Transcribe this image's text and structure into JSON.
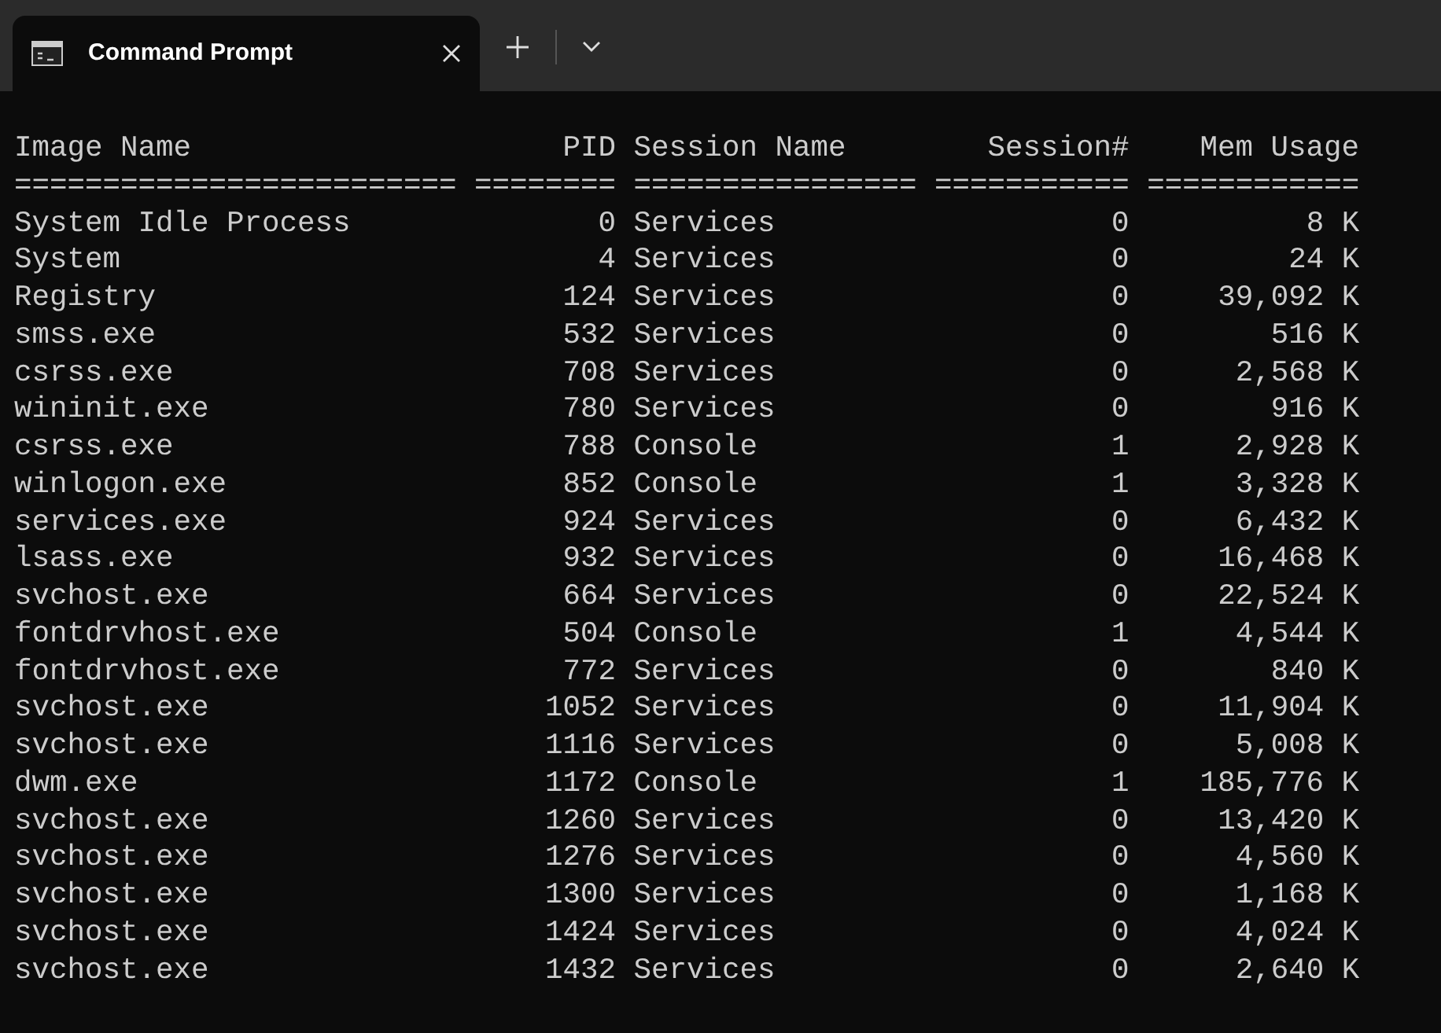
{
  "tabs": [
    {
      "title": "Command Prompt",
      "selected": true
    }
  ],
  "table": {
    "columns": [
      {
        "heading": "Image Name",
        "rule": "========================="
      },
      {
        "heading": "PID",
        "rule": "========"
      },
      {
        "heading": "Session Name",
        "rule": "================"
      },
      {
        "heading": "Session#",
        "rule": "==========="
      },
      {
        "heading": "Mem Usage",
        "rule": "============"
      }
    ],
    "rows": [
      [
        "System Idle Process",
        "0",
        "Services",
        "0",
        "8 K"
      ],
      [
        "System",
        "4",
        "Services",
        "0",
        "24 K"
      ],
      [
        "Registry",
        "124",
        "Services",
        "0",
        "39,092 K"
      ],
      [
        "smss.exe",
        "532",
        "Services",
        "0",
        "516 K"
      ],
      [
        "csrss.exe",
        "708",
        "Services",
        "0",
        "2,568 K"
      ],
      [
        "wininit.exe",
        "780",
        "Services",
        "0",
        "916 K"
      ],
      [
        "csrss.exe",
        "788",
        "Console",
        "1",
        "2,928 K"
      ],
      [
        "winlogon.exe",
        "852",
        "Console",
        "1",
        "3,328 K"
      ],
      [
        "services.exe",
        "924",
        "Services",
        "0",
        "6,432 K"
      ],
      [
        "lsass.exe",
        "932",
        "Services",
        "0",
        "16,468 K"
      ],
      [
        "svchost.exe",
        "664",
        "Services",
        "0",
        "22,524 K"
      ],
      [
        "fontdrvhost.exe",
        "504",
        "Console",
        "1",
        "4,544 K"
      ],
      [
        "fontdrvhost.exe",
        "772",
        "Services",
        "0",
        "840 K"
      ],
      [
        "svchost.exe",
        "1052",
        "Services",
        "0",
        "11,904 K"
      ],
      [
        "svchost.exe",
        "1116",
        "Services",
        "0",
        "5,008 K"
      ],
      [
        "dwm.exe",
        "1172",
        "Console",
        "1",
        "185,776 K"
      ],
      [
        "svchost.exe",
        "1260",
        "Services",
        "0",
        "13,420 K"
      ],
      [
        "svchost.exe",
        "1276",
        "Services",
        "0",
        "4,560 K"
      ],
      [
        "svchost.exe",
        "1300",
        "Services",
        "0",
        "1,168 K"
      ],
      [
        "svchost.exe",
        "1424",
        "Services",
        "0",
        "4,024 K"
      ],
      [
        "svchost.exe",
        "1432",
        "Services",
        "0",
        "2,640 K"
      ]
    ]
  }
}
